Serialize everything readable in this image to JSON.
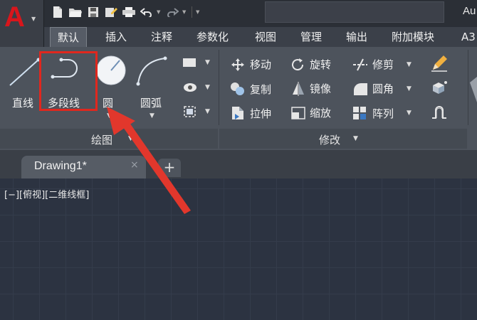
{
  "titlebar": {
    "app_title": "Au"
  },
  "tabs": [
    "默认",
    "插入",
    "注释",
    "参数化",
    "视图",
    "管理",
    "输出",
    "附加模块",
    "A3"
  ],
  "draw_panel": {
    "line_label": "直线",
    "polyline_label": "多段线",
    "circle_label": "圆",
    "arc_label": "圆弧",
    "title": "绘图"
  },
  "modify_panel": {
    "move": "移动",
    "rotate": "旋转",
    "trim": "修剪",
    "copy": "复制",
    "mirror": "镜像",
    "fillet": "圆角",
    "stretch": "拉伸",
    "scale": "缩放",
    "array": "阵列",
    "title": "修改"
  },
  "document": {
    "tab_label": "Drawing1*",
    "close_glyph": "×",
    "new_tab_glyph": "+"
  },
  "viewport": {
    "label": "[−][俯视][二维线框]"
  },
  "colors": {
    "highlight": "#e0271e",
    "logo": "#d8161c",
    "canvas": "#2c3341"
  }
}
